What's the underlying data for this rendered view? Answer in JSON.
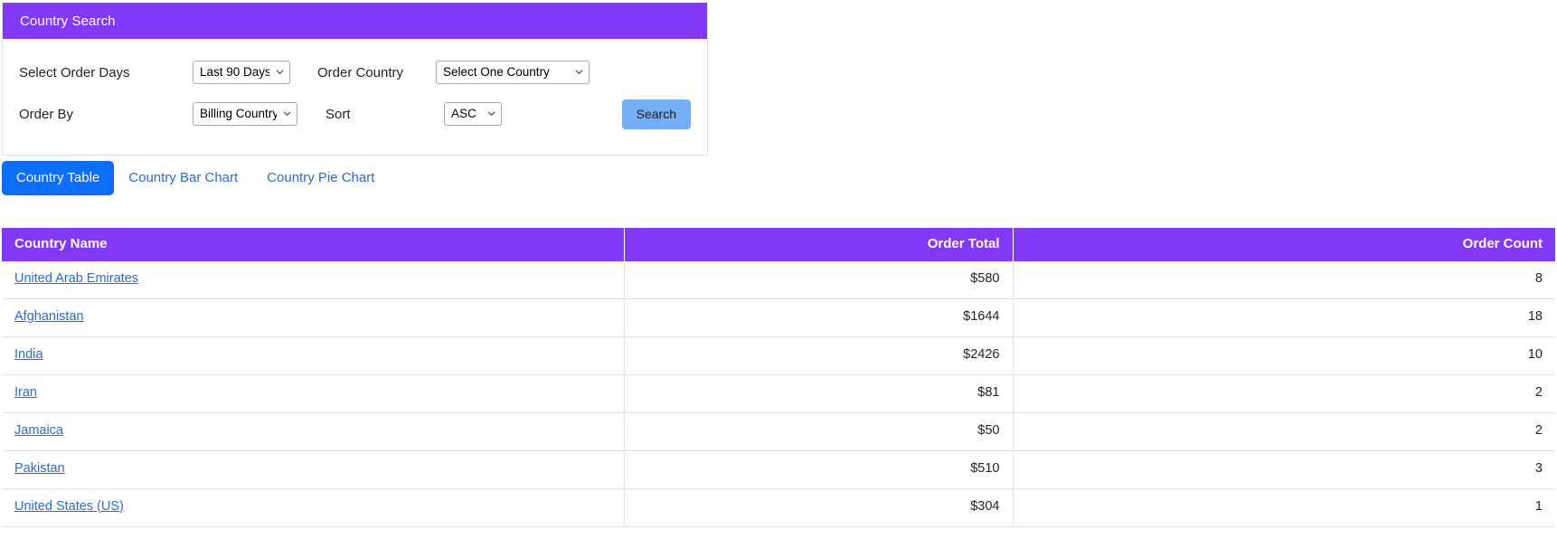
{
  "search_panel": {
    "title": "Country Search",
    "fields": {
      "order_days_label": "Select Order Days",
      "order_days_value": "Last 90 Days",
      "order_country_label": "Order Country",
      "order_country_value": "Select One Country",
      "order_by_label": "Order By",
      "order_by_value": "Billing Country",
      "sort_label": "Sort",
      "sort_value": "ASC"
    },
    "search_button_label": "Search"
  },
  "tabs": [
    {
      "label": "Country Table",
      "active": true
    },
    {
      "label": "Country Bar Chart",
      "active": false
    },
    {
      "label": "Country Pie Chart",
      "active": false
    }
  ],
  "table": {
    "columns": [
      "Country Name",
      "Order Total",
      "Order Count"
    ],
    "rows": [
      {
        "country": "United Arab Emirates",
        "order_total": "$580",
        "order_count": "8"
      },
      {
        "country": "Afghanistan",
        "order_total": "$1644",
        "order_count": "18"
      },
      {
        "country": "India",
        "order_total": "$2426",
        "order_count": "10"
      },
      {
        "country": "Iran",
        "order_total": "$81",
        "order_count": "2"
      },
      {
        "country": "Jamaica",
        "order_total": "$50",
        "order_count": "2"
      },
      {
        "country": "Pakistan",
        "order_total": "$510",
        "order_count": "3"
      },
      {
        "country": "United States (US)",
        "order_total": "$304",
        "order_count": "1"
      }
    ]
  },
  "colors": {
    "header_purple": "#8338f7",
    "tab_active_blue": "#0d6efd",
    "link_blue": "#2b6cd4",
    "search_button_blue": "#73aef7"
  }
}
